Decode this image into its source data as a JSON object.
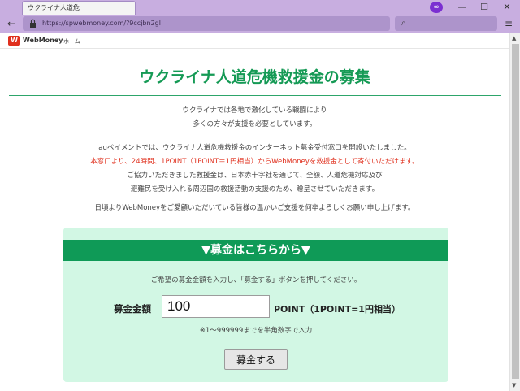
{
  "browser": {
    "tab_title": "ウクライナ人道危",
    "private_glyph": "∞",
    "minimize": "—",
    "maximize": "☐",
    "close": "✕",
    "back": "←",
    "url": "https://spwebmoney.com/?9ccjbn2gl",
    "search_glyph": "⌕",
    "menu_glyph": "≡",
    "accent_color": "#c8aee0"
  },
  "site": {
    "logo_mark": "W",
    "logo_text": "WebMoney",
    "nav_home": "ホーム",
    "brand_color": "#e0301e"
  },
  "content": {
    "title": "ウクライナ人道危機救援金の募集",
    "intro_line1": "ウクライナでは各地で激化している戦闘により",
    "intro_line2": "多くの方々が支援を必要としています。",
    "body_line1": "auペイメントでは、ウクライナ人道危機救援金のインターネット募金受付窓口を開設いたしました。",
    "body_red_line": "本窓口より、24時間、1POINT（1POINT＝1円相当）からWebMoneyを救援金として寄付いただけます。",
    "body_line3": "ご協力いただきました救援金は、日本赤十字社を通じて、全額、人道危機対応及び",
    "body_line4": "避難民を受け入れる周辺国の救援活動の支援のため、贈呈させていただきます。",
    "thanks_line": "日頃よりWebMoneyをご愛顧いただいている皆様の温かいご支援を何卒よろしくお願い申し上げます。",
    "title_color": "#159a55"
  },
  "donation": {
    "header": "▼募金はこちらから▼",
    "instruction": "ご希望の募金金額を入力し、「募金する」ボタンを押してください。",
    "amount_label": "募金金額",
    "amount_value": "100",
    "point_label": "POINT（1POINT=1円相当）",
    "note": "※1〜999999までを半角数字で入力",
    "submit_label": "募金する",
    "header_color": "#0f9a57",
    "box_color": "#d2f7e4"
  }
}
